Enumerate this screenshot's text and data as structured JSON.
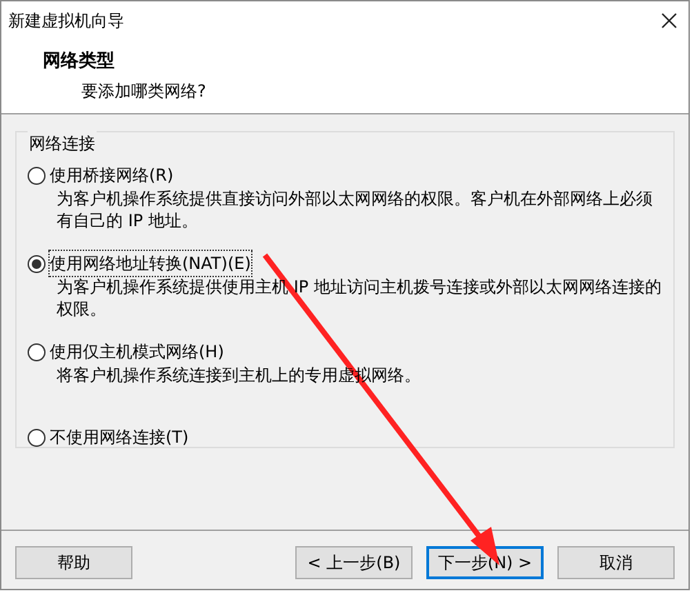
{
  "window": {
    "title": "新建虚拟机向导"
  },
  "header": {
    "title": "网络类型",
    "subtitle": "要添加哪类网络?"
  },
  "group": {
    "title": "网络连接",
    "options": [
      {
        "label": "使用桥接网络(R)",
        "description": "为客户机操作系统提供直接访问外部以太网网络的权限。客户机在外部网络上必须有自己的 IP 地址。",
        "selected": false
      },
      {
        "label": "使用网络地址转换(NAT)(E)",
        "description": "为客户机操作系统提供使用主机 IP 地址访问主机拨号连接或外部以太网网络连接的权限。",
        "selected": true
      },
      {
        "label": "使用仅主机模式网络(H)",
        "description": "将客户机操作系统连接到主机上的专用虚拟网络。",
        "selected": false
      },
      {
        "label": "不使用网络连接(T)",
        "selected": false
      }
    ]
  },
  "buttons": [
    {
      "label": "帮助",
      "focused": false
    },
    {
      "label": "< 上一步(B)",
      "focused": false
    },
    {
      "label": "下一步(N) >",
      "focused": true
    },
    {
      "label": "取消",
      "focused": false
    }
  ]
}
